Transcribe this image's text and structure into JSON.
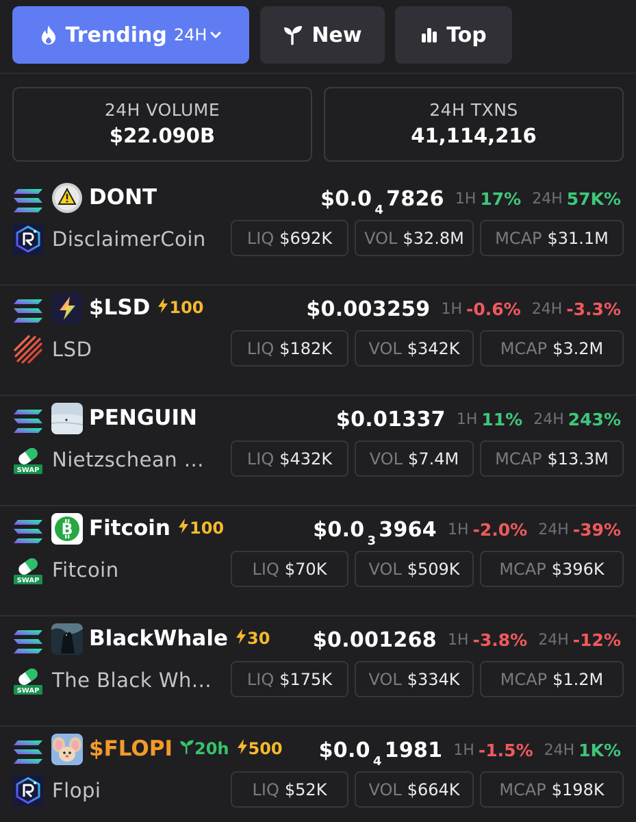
{
  "tabs": {
    "trending": {
      "label": "Trending",
      "period": "24H"
    },
    "new": {
      "label": "New"
    },
    "top": {
      "label": "Top"
    }
  },
  "stats": {
    "volume": {
      "label": "24H VOLUME",
      "value": "$22.090B"
    },
    "txns": {
      "label": "24H TXNS",
      "value": "41,114,216"
    }
  },
  "colors": {
    "accent": "#5f7cf2",
    "up": "#3fc77a",
    "down": "#f0595c",
    "boost": "#f5b82e",
    "new_age": "#35c46b"
  },
  "tokens": [
    {
      "symbol": "DONT",
      "name": "DisclaimerCoin",
      "boost": "",
      "age": "",
      "price_prefix": "$0.0",
      "price_zeros": "4",
      "price_rest": "7826",
      "h1_label": "1H",
      "h1_change": "17%",
      "h1_dir": "up",
      "h24_label": "24H",
      "h24_change": "57K%",
      "h24_dir": "up",
      "liq_label": "LIQ",
      "liq": "$692K",
      "vol_label": "VOL",
      "vol": "$32.8M",
      "mcap_label": "MCAP",
      "mcap": "$31.1M",
      "avatar_icon": "warning-coin-icon",
      "dex_icon": "raydium-icon"
    },
    {
      "symbol": "$LSD",
      "name": "LSD",
      "boost": "100",
      "age": "",
      "price_prefix": "$0.003259",
      "price_zeros": "",
      "price_rest": "",
      "h1_label": "1H",
      "h1_change": "-0.6%",
      "h1_dir": "down",
      "h24_label": "24H",
      "h24_change": "-3.3%",
      "h24_dir": "down",
      "liq_label": "LIQ",
      "liq": "$182K",
      "vol_label": "VOL",
      "vol": "$342K",
      "mcap_label": "MCAP",
      "mcap": "$3.2M",
      "avatar_icon": "lightning-logo-icon",
      "dex_icon": "lsd-stripes-icon"
    },
    {
      "symbol": "PENGUIN",
      "name": "Nietzschean ...",
      "boost": "",
      "age": "",
      "price_prefix": "$0.01337",
      "price_zeros": "",
      "price_rest": "",
      "h1_label": "1H",
      "h1_change": "11%",
      "h1_dir": "up",
      "h24_label": "24H",
      "h24_change": "243%",
      "h24_dir": "up",
      "liq_label": "LIQ",
      "liq": "$432K",
      "vol_label": "VOL",
      "vol": "$7.4M",
      "mcap_label": "MCAP",
      "mcap": "$13.3M",
      "avatar_icon": "snow-photo-icon",
      "dex_icon": "swap-icon"
    },
    {
      "symbol": "Fitcoin",
      "name": "Fitcoin",
      "boost": "100",
      "age": "",
      "price_prefix": "$0.0",
      "price_zeros": "3",
      "price_rest": "3964",
      "h1_label": "1H",
      "h1_change": "-2.0%",
      "h1_dir": "down",
      "h24_label": "24H",
      "h24_change": "-39%",
      "h24_dir": "down",
      "liq_label": "LIQ",
      "liq": "$70K",
      "vol_label": "VOL",
      "vol": "$509K",
      "mcap_label": "MCAP",
      "mcap": "$396K",
      "avatar_icon": "bitcoin-green-icon",
      "dex_icon": "swap-icon"
    },
    {
      "symbol": "BlackWhale",
      "name": "The Black Wh...",
      "boost": "30",
      "age": "",
      "price_prefix": "$0.001268",
      "price_zeros": "",
      "price_rest": "",
      "h1_label": "1H",
      "h1_change": "-3.8%",
      "h1_dir": "down",
      "h24_label": "24H",
      "h24_change": "-12%",
      "h24_dir": "down",
      "liq_label": "LIQ",
      "liq": "$175K",
      "vol_label": "VOL",
      "vol": "$334K",
      "mcap_label": "MCAP",
      "mcap": "$1.2M",
      "avatar_icon": "whale-photo-icon",
      "dex_icon": "swap-icon"
    },
    {
      "symbol": "$FLOPI",
      "name": "Flopi",
      "boost": "500",
      "age": "20h",
      "price_prefix": "$0.0",
      "price_zeros": "4",
      "price_rest": "1981",
      "h1_label": "1H",
      "h1_change": "-1.5%",
      "h1_dir": "down",
      "h24_label": "24H",
      "h24_change": "1K%",
      "h24_dir": "up",
      "liq_label": "LIQ",
      "liq": "$52K",
      "vol_label": "VOL",
      "vol": "$664K",
      "mcap_label": "MCAP",
      "mcap": "$198K",
      "avatar_icon": "cartoon-mouse-icon",
      "dex_icon": "raydium-icon"
    }
  ]
}
